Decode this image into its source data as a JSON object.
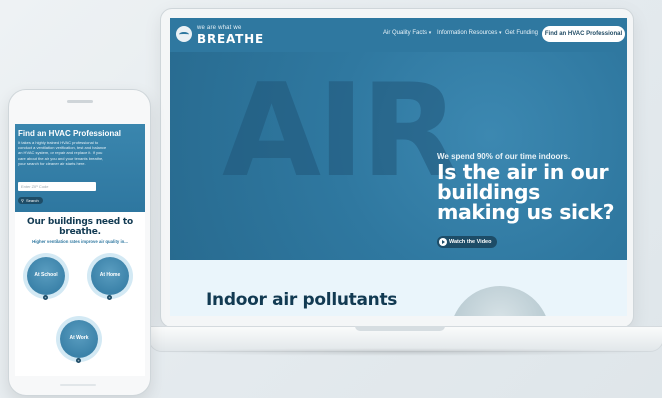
{
  "laptop": {
    "logo": {
      "tagline": "we are what we",
      "wordmark": "BREATHE"
    },
    "nav": {
      "items": [
        {
          "label": "Air Quality Facts",
          "caret": "▾"
        },
        {
          "label": "Information Resources",
          "caret": "▾"
        },
        {
          "label": "Get Funding",
          "caret": ""
        }
      ],
      "cta": "Find an HVAC Professional"
    },
    "hero": {
      "background_word": "AIR",
      "pre_title": "We spend 90% of our time indoors.",
      "headline": "Is the air in our buildings making us sick?",
      "button": "Watch the Video"
    },
    "section": {
      "title": "Indoor air pollutants"
    }
  },
  "phone": {
    "hero": {
      "title": "Find an HVAC Professional",
      "body": "It takes a highly trained HVAC professional to conduct a ventilation verification, test and balance an HVAC system, or repair and replace it. If you care about the air you and your tenants breathe, your search for cleaner air starts here.",
      "zip_placeholder": "Enter ZIP Code",
      "search_button": "Search"
    },
    "heading": "Our buildings need to breathe.",
    "subheading": "Higher ventilation rates improve air quality in...",
    "cards": [
      {
        "label": "At School"
      },
      {
        "label": "At Home"
      },
      {
        "label": "At Work"
      }
    ]
  },
  "colors": {
    "brand_blue": "#2f78a0",
    "navy": "#123a52",
    "light_section": "#eaf5fb"
  }
}
